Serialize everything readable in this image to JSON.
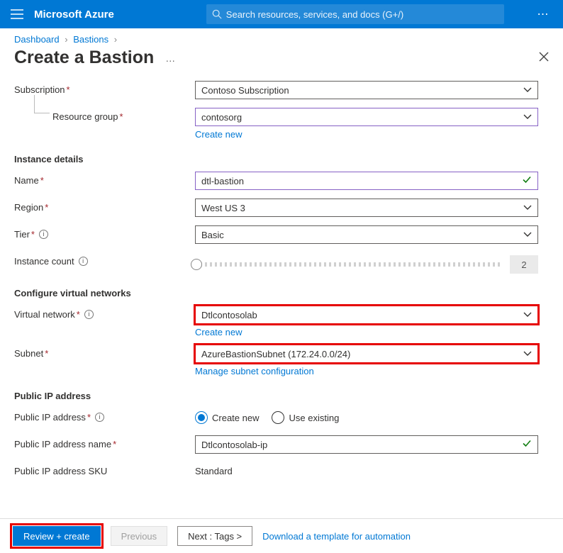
{
  "topbar": {
    "brand": "Microsoft Azure",
    "search_placeholder": "Search resources, services, and docs (G+/)"
  },
  "breadcrumb": {
    "dashboard": "Dashboard",
    "bastions": "Bastions"
  },
  "page": {
    "title": "Create a Bastion"
  },
  "form": {
    "subscription": {
      "label": "Subscription",
      "value": "Contoso Subscription"
    },
    "resource_group": {
      "label": "Resource group",
      "value": "contosorg",
      "create_new": "Create new"
    },
    "section_instance": "Instance details",
    "name": {
      "label": "Name",
      "value": "dtl-bastion"
    },
    "region": {
      "label": "Region",
      "value": "West US 3"
    },
    "tier": {
      "label": "Tier",
      "value": "Basic"
    },
    "instance_count": {
      "label": "Instance count",
      "value": "2"
    },
    "section_vnet": "Configure virtual networks",
    "vnet": {
      "label": "Virtual network",
      "value": "Dtlcontosolab",
      "create_new": "Create new"
    },
    "subnet": {
      "label": "Subnet",
      "value": "AzureBastionSubnet (172.24.0.0/24)",
      "manage": "Manage subnet configuration"
    },
    "section_pip": "Public IP address",
    "pip": {
      "label": "Public IP address",
      "opt_new": "Create new",
      "opt_existing": "Use existing"
    },
    "pip_name": {
      "label": "Public IP address name",
      "value": "Dtlcontosolab-ip"
    },
    "pip_sku": {
      "label": "Public IP address SKU",
      "value": "Standard"
    }
  },
  "footer": {
    "review": "Review + create",
    "previous": "Previous",
    "next": "Next : Tags >",
    "download": "Download a template for automation"
  }
}
